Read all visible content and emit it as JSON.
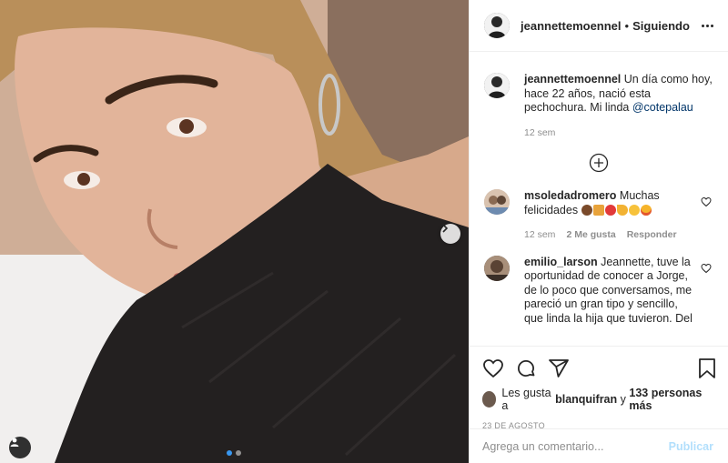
{
  "post": {
    "author": "jeannettemoennel",
    "separator": "•",
    "follow_status": "Siguiendo"
  },
  "caption": {
    "username": "jeannettemoennel",
    "text": "Un día como hoy, hace 22 años, nació esta pechochura. Mi linda ",
    "mention": "@cotepalau",
    "time": "12 sem"
  },
  "comments": [
    {
      "username": "msoledadromero",
      "text": "Muchas felicidades",
      "emojis": [
        "cake-emoji",
        "gift-emoji",
        "balloon-emoji",
        "party-popper-emoji",
        "blush-emoji",
        "star-struck-emoji"
      ],
      "time": "12 sem",
      "likes": "2 Me gusta",
      "reply": "Responder"
    },
    {
      "username": "emilio_larson",
      "text": "Jeannette, tuve la oportunidad de conocer a Jorge, de lo poco que conversamos, me pareció un gran tipo y sencillo, que linda la hija que tuvieron. Del"
    }
  ],
  "likes": {
    "prefix": "Les gusta a",
    "user": "blanquifran",
    "middle": "y",
    "others": "133 personas más"
  },
  "date": "23 DE AGOSTO",
  "composer": {
    "placeholder": "Agrega un comentario...",
    "post_label": "Publicar"
  },
  "carousel": {
    "total": 2,
    "current": 1
  },
  "colors": {
    "accent": "#3897f0",
    "text": "#262626",
    "muted": "#8e8e8e",
    "post_disabled": "#b2dffc"
  },
  "icons": [
    "more-icon",
    "add-circle-icon",
    "heart-icon",
    "comment-icon",
    "share-icon",
    "bookmark-icon",
    "chevron-right-icon",
    "user-tag-icon"
  ]
}
